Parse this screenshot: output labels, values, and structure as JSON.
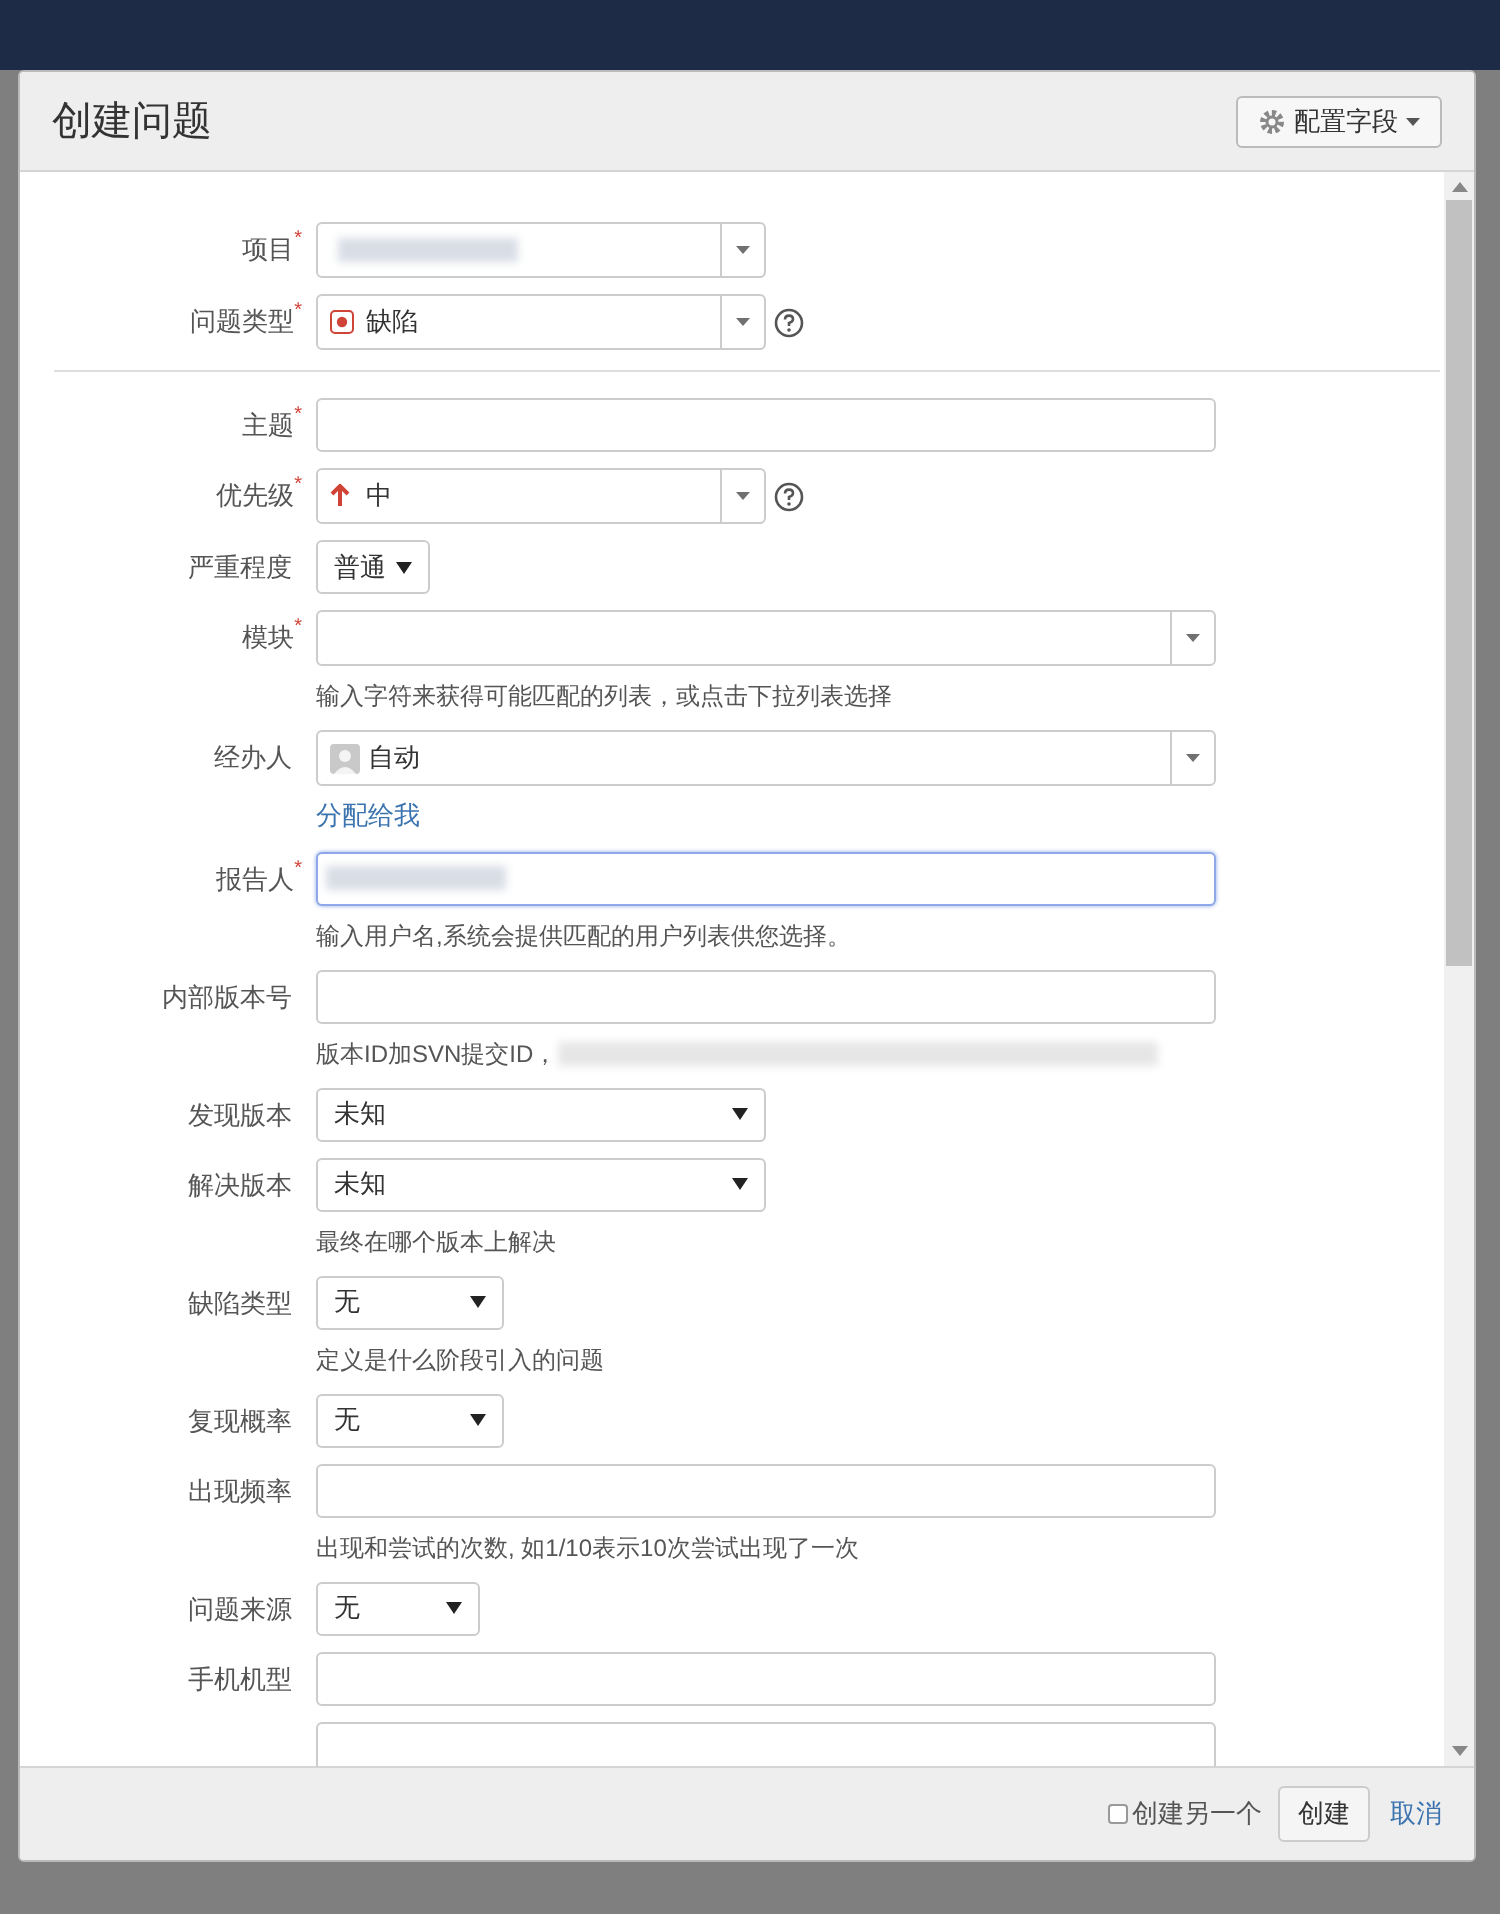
{
  "dialog": {
    "title": "创建问题",
    "config_button": "配置字段"
  },
  "top_fields": [
    {
      "label": "项目",
      "marker": "*",
      "kind": "shortpicker",
      "redacted": true
    },
    {
      "label": "问题类型",
      "marker": "*",
      "kind": "typepicker",
      "value": "缺陷",
      "help_icon": true
    }
  ],
  "fields": [
    {
      "label": "主题",
      "marker": "*",
      "kind": "text"
    },
    {
      "label": "优先级",
      "marker": "*",
      "kind": "prioritypicker",
      "value": "中",
      "help_icon": true
    },
    {
      "label": "严重程度",
      "kind": "tinyselect",
      "value": "普通"
    },
    {
      "label": "模块",
      "marker": "*",
      "kind": "widepicker",
      "help": "输入字符来获得可能匹配的列表，或点击下拉列表选择"
    },
    {
      "label": "经办人",
      "kind": "userpicker",
      "value": "自动",
      "link": "分配给我"
    },
    {
      "label": "报告人",
      "marker": "*",
      "kind": "text",
      "redacted": true,
      "focused": true,
      "help": "输入用户名,系统会提供匹配的用户列表供您选择。"
    },
    {
      "label": "内部版本号",
      "kind": "text",
      "help": "版本ID加SVN提交ID，",
      "help_redacted": true
    },
    {
      "label": "发现版本",
      "kind": "select",
      "value": "未知"
    },
    {
      "label": "解决版本",
      "kind": "select",
      "value": "未知",
      "help": "最终在哪个版本上解决"
    },
    {
      "label": "缺陷类型",
      "kind": "smallselect",
      "value": "无",
      "help": "定义是什么阶段引入的问题"
    },
    {
      "label": "复现概率",
      "kind": "smallselect",
      "value": "无"
    },
    {
      "label": "出现频率",
      "kind": "text",
      "help": "出现和尝试的次数, 如1/10表示10次尝试出现了一次"
    },
    {
      "label": "问题来源",
      "kind": "narrowselect",
      "value": "无"
    },
    {
      "label": "手机机型",
      "kind": "text"
    },
    {
      "kind": "text"
    }
  ],
  "footer": {
    "create_another": {
      "label": "创建另一个",
      "checked": false
    },
    "create_button": "创建",
    "cancel_link": "取消"
  }
}
